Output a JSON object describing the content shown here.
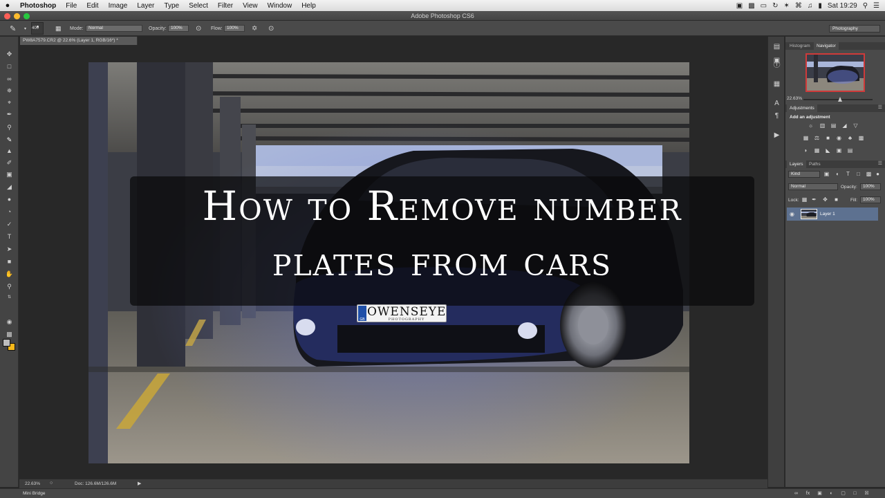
{
  "menubar": {
    "apple": "",
    "app": "Photoshop",
    "items": [
      "File",
      "Edit",
      "Image",
      "Layer",
      "Type",
      "Select",
      "Filter",
      "View",
      "Window",
      "Help"
    ],
    "clock": "Sat 19:29"
  },
  "window": {
    "title": "Adobe Photoshop CS6"
  },
  "options_bar": {
    "brush_size": "400",
    "mode_label": "Mode:",
    "mode_value": "Normal",
    "opacity_label": "Opacity:",
    "opacity_value": "100%",
    "flow_label": "Flow:",
    "flow_value": "100%",
    "workspace": "Photography"
  },
  "document": {
    "tab_title": "PW8A7579.CR2 @ 22.6% (Layer 1, RGB/16*) *"
  },
  "overlay": {
    "line1": "How to Remove number",
    "line2": "plates from cars"
  },
  "plate": {
    "country": "GB",
    "text": "OWENSEYE",
    "subtext": "PHOTOGRAPHY"
  },
  "status_bar": {
    "zoom": "22.63%",
    "doc": "Doc: 126.6M/126.6M"
  },
  "mini_bridge": "Mini Bridge",
  "panels": {
    "top_tabs": [
      "Histogram",
      "Navigator"
    ],
    "navigator_zoom": "22.63%",
    "adjustments_tab": "Adjustments",
    "adjustments_label": "Add an adjustment",
    "layers_tabs": [
      "Layers",
      "Paths"
    ],
    "kind_label": "Kind",
    "blend_mode": "Normal",
    "opacity_label": "Opacity:",
    "opacity_value": "100%",
    "lock_label": "Lock:",
    "fill_label": "Fill:",
    "fill_value": "100%",
    "layer_name": "Layer 1"
  },
  "colors": {
    "foreground": "#bdbdbd",
    "background": "#f6b81a",
    "selected_layer": "#5d7190",
    "navigator_frame": "#d03a3a"
  }
}
